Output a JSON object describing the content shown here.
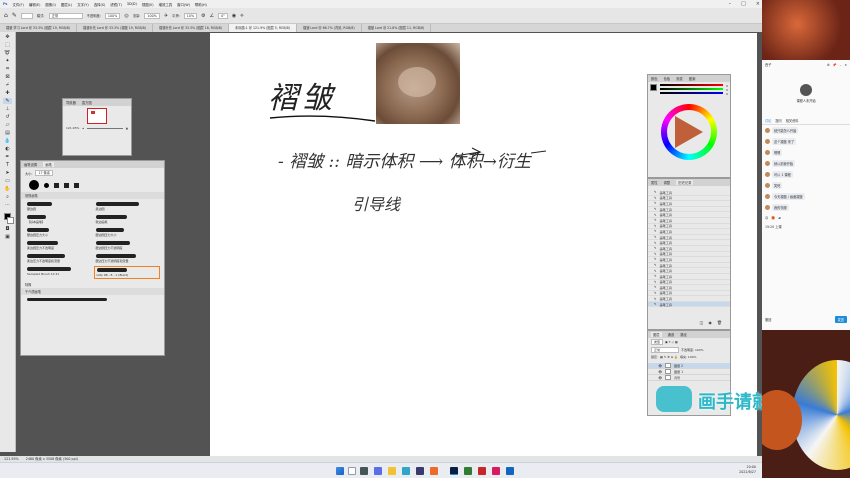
{
  "menubar": {
    "items": [
      "文件(F)",
      "编辑(E)",
      "图像(I)",
      "图层(L)",
      "文字(Y)",
      "选择(S)",
      "滤镜(T)",
      "3D(D)",
      "视图(V)",
      "增效工具",
      "窗口(W)",
      "帮助(H)"
    ]
  },
  "options": {
    "mode_label": "模式:",
    "mode_value": "正常",
    "opacity_label": "不透明度:",
    "opacity_value": "100%",
    "flow_label": "流量:",
    "flow_value": "100%",
    "smooth_label": "平滑:",
    "smooth_value": "10%",
    "angle_value": "0°"
  },
  "doc_tabs": [
    {
      "label": "褶皱 学习 Lord @ 33.3% (图层 19, RGB/8)",
      "active": false
    },
    {
      "label": "褶皱补充 Lord @ 33.3% (褶皱 19, RGB/8)",
      "active": false
    },
    {
      "label": "褶皱补充 Lord @ 33.3% (图层 18, RGB/8)",
      "active": false
    },
    {
      "label": "未标题-1 @ 121.9% (图层 5, RGB/8)",
      "active": true
    },
    {
      "label": "褶皱 Lord @ 66.7% (背景, RGB/8)",
      "active": false
    },
    {
      "label": "褶皱 Lord @ 21.8% (图层 11, RGB/8)",
      "active": false
    }
  ],
  "tools": [
    "move",
    "marquee",
    "lasso",
    "wand",
    "crop",
    "frame",
    "eyedropper",
    "heal",
    "brush",
    "stamp",
    "history",
    "eraser",
    "gradient",
    "blur",
    "dodge",
    "pen",
    "type",
    "path",
    "shape",
    "hand",
    "zoom",
    "more"
  ],
  "canvas": {
    "title": "褶皱",
    "line1": "- 褶皱 :: 暗示体积 ⟶ 体积→衍生",
    "line2": "引导线"
  },
  "navigator": {
    "tabs": [
      "导航器",
      "直方图"
    ],
    "zoom": "121.95%"
  },
  "brush_panel": {
    "tabs": [
      "画笔设置",
      "画笔"
    ],
    "size": "17 像素",
    "group": "常规画笔",
    "brushes": [
      {
        "name": "硬边圆",
        "w": 0.4
      },
      {
        "name": "柔边圆",
        "w": 0.7
      },
      {
        "name": "【基本画笔】",
        "w": 0.3
      },
      {
        "name": "软边画笔",
        "w": 0.5
      },
      {
        "name": "硬边圆压力大小",
        "w": 0.35
      },
      {
        "name": "硬边圆压力大小",
        "w": 0.45
      },
      {
        "name": "柔边圆压力不透明度",
        "w": 0.5
      },
      {
        "name": "硬边圆压力不透明度",
        "w": 0.55
      },
      {
        "name": "柔边压力不透明度和流量",
        "w": 0.6
      },
      {
        "name": "硬边压力不透明度和流量",
        "w": 0.65
      },
      {
        "name": "Sampled Brush 10 21",
        "w": 0.7
      },
      {
        "name": "LOG 98 - 8 - 1 (Build)",
        "w": 0.5
      }
    ],
    "footer_items": [
      "特殊",
      "干介质画笔"
    ]
  },
  "color_panel": {
    "tabs": [
      "颜色",
      "色板",
      "渐变",
      "图案"
    ],
    "r": "0",
    "g": "0",
    "b": "0"
  },
  "history_panel": {
    "tabs": [
      "属性",
      "调整",
      "历史记录"
    ],
    "items": [
      "画笔工具",
      "画笔工具",
      "画笔工具",
      "画笔工具",
      "画笔工具",
      "画笔工具",
      "画笔工具",
      "画笔工具",
      "画笔工具",
      "画笔工具",
      "画笔工具",
      "画笔工具",
      "画笔工具",
      "画笔工具",
      "画笔工具",
      "画笔工具",
      "画笔工具",
      "画笔工具",
      "画笔工具",
      "画笔工具",
      "画笔工具"
    ]
  },
  "layers_panel": {
    "tabs": [
      "图层",
      "通道",
      "路径"
    ],
    "kind": "类型",
    "blend": "正常",
    "opacity": "不透明度: 100%",
    "lock": "锁定:",
    "fill": "填充: 100%",
    "layers": [
      "图层 2",
      "图层 1",
      "背景"
    ]
  },
  "status": {
    "zoom": "121.95%",
    "doc": "2480 像素 x 3508 像素 (300 ppi)"
  },
  "watermark": "画手请就位",
  "chat": {
    "header": "西子",
    "stage_label": "课程人未开始",
    "tabs": [
      "讨论",
      "提问",
      "相关资料"
    ],
    "messages": [
      {
        "user": "",
        "text": "就只能怎么开始"
      },
      {
        "user": "",
        "text": "这个褶皱 来了"
      },
      {
        "user": "",
        "text": "嗯嗯"
      },
      {
        "user": "",
        "text": "就以前我开始"
      },
      {
        "user": "",
        "text": "可以 1 课程"
      },
      {
        "user": "",
        "text": "笑死"
      },
      {
        "user": "",
        "text": "今天褶皱 / 画面褶皱"
      },
      {
        "user": "",
        "text": "我的衣服"
      }
    ],
    "course_time": "19:20 上课",
    "input_placeholder": "撤回",
    "send_label": "发送"
  },
  "taskbar": {
    "time": "20:00",
    "date": "2022/8/27"
  },
  "colors": {
    "accent": "#1e8cd8",
    "watermark": "#2bb8c8",
    "highlight": "#f08020"
  }
}
